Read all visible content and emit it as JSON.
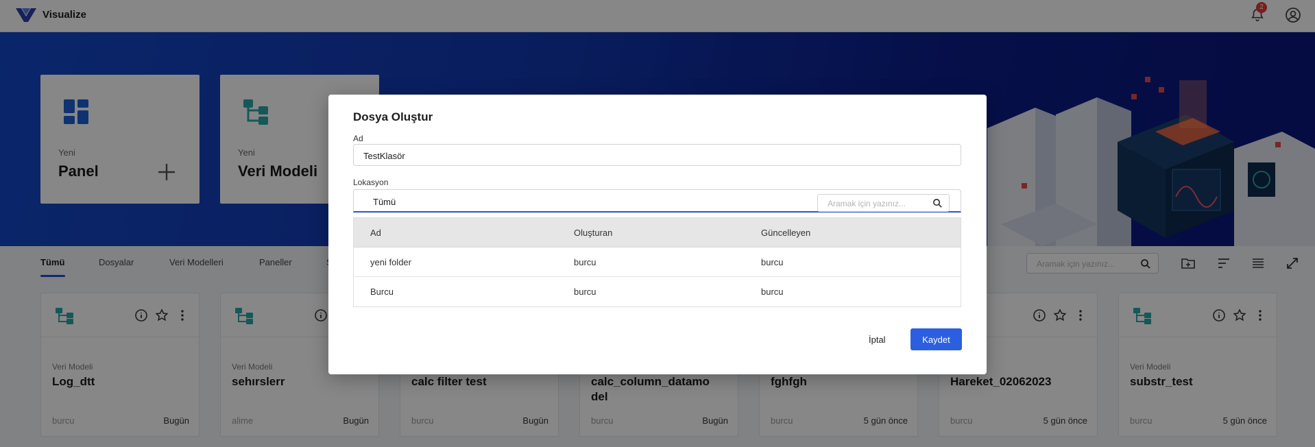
{
  "app": {
    "title": "Visualize",
    "notification_count": "2"
  },
  "hero": {
    "cards": [
      {
        "subtitle": "Yeni",
        "title": "Panel"
      },
      {
        "subtitle": "Yeni",
        "title": "Veri Modeli"
      }
    ]
  },
  "tabs": [
    "Tümü",
    "Dosyalar",
    "Veri Modelleri",
    "Paneller",
    "S"
  ],
  "search": {
    "placeholder": "Aramak için yazınız..."
  },
  "items": [
    {
      "type": "Veri Modeli",
      "name": "Log_dtt",
      "owner": "burcu",
      "updated": "Bugün"
    },
    {
      "type": "Veri Modeli",
      "name": "sehırslerr",
      "owner": "alime",
      "updated": "Bugün"
    },
    {
      "type": "",
      "name": "calc filter test",
      "owner": "burcu",
      "updated": "Bugün"
    },
    {
      "type": "",
      "name": "calc_column_datamo\ndel",
      "owner": "burcu",
      "updated": "Bugün"
    },
    {
      "type": "",
      "name": "fghfgh",
      "owner": "burcu",
      "updated": "5 gün önce"
    },
    {
      "type": "",
      "name": "Hareket_02062023",
      "owner": "burcu",
      "updated": "5 gün önce"
    },
    {
      "type": "Veri Modeli",
      "name": "substr_test",
      "owner": "burcu",
      "updated": "5 gün önce"
    }
  ],
  "modal": {
    "title": "Dosya Oluştur",
    "name_label": "Ad",
    "name_value": "TestKlasör",
    "location_label": "Lokasyon",
    "location_selected": "Tümü",
    "location_search_placeholder": "Aramak için yazınız...",
    "columns": [
      "Ad",
      "Oluşturan",
      "Güncelleyen"
    ],
    "rows": [
      [
        "yeni folder",
        "burcu",
        "burcu"
      ],
      [
        "Burcu",
        "burcu",
        "burcu"
      ]
    ],
    "cancel_label": "İptal",
    "save_label": "Kaydet"
  },
  "colors": {
    "primary": "#2b5fe0",
    "hero_start": "#1448c8",
    "hero_end": "#0a167a",
    "icon_teal": "#2aa6a6",
    "panel_icon_blue": "#1d5fd6"
  }
}
